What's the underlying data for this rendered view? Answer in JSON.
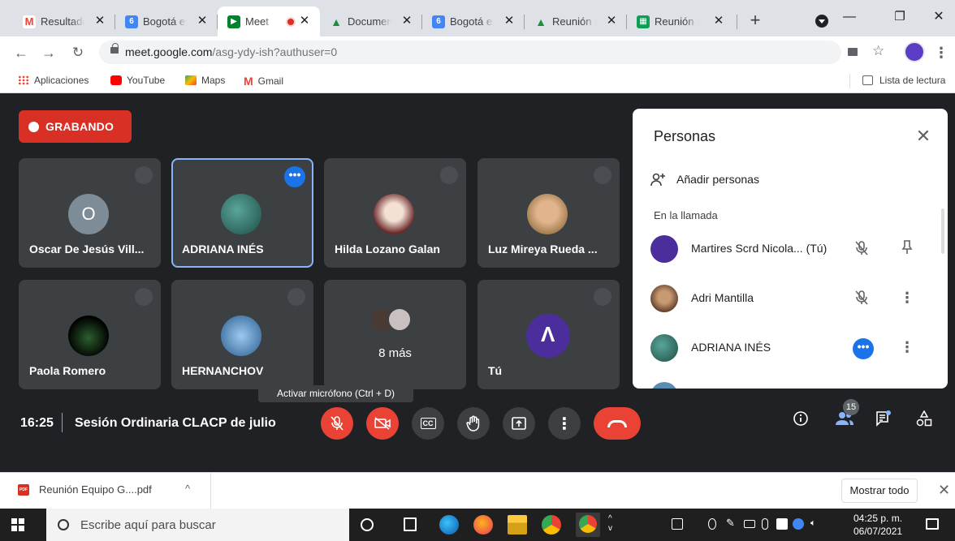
{
  "browser": {
    "tabs": [
      {
        "title": "Resultados",
        "favicon": "gmail-icon",
        "color": "#ea4335"
      },
      {
        "title": "Bogotá es",
        "favicon": "calendar-icon",
        "color": "#4285f4"
      },
      {
        "title": "Meet",
        "favicon": "meet-icon",
        "color": "#00832d"
      },
      {
        "title": "Documento",
        "favicon": "drive-icon",
        "color": "#1e8e3e"
      },
      {
        "title": "Bogotá es",
        "favicon": "calendar-icon",
        "color": "#4285f4"
      },
      {
        "title": "Reunión E",
        "favicon": "drive-icon",
        "color": "#1e8e3e"
      },
      {
        "title": "Reunión E",
        "favicon": "sheets-icon",
        "color": "#0f9d58"
      }
    ],
    "url_host": "meet.google.com",
    "url_path": "/asg-ydy-ish?authuser=0",
    "bookmarks": [
      "Aplicaciones",
      "YouTube",
      "Maps",
      "Gmail"
    ],
    "reading_list": "Lista de lectura"
  },
  "meet": {
    "recording_label": "GRABANDO",
    "tiles": [
      {
        "name": "Oscar De Jesús Vill...",
        "initial": "O"
      },
      {
        "name": "ADRIANA INÉS"
      },
      {
        "name": "Hilda Lozano Galan"
      },
      {
        "name": "Luz Mireya Rueda ..."
      },
      {
        "name": "Paola Romero"
      },
      {
        "name": "HERNANCHOV"
      },
      {
        "name": "",
        "more_label": "8 más"
      },
      {
        "name": "Tú"
      }
    ],
    "tooltip": "Activar micrófono (Ctrl + D)",
    "time": "16:25",
    "meeting_name": "Sesión Ordinaria CLACP de julio",
    "people_count": "15",
    "panel": {
      "title": "Personas",
      "add_people": "Añadir personas",
      "section": "En la llamada",
      "participants": [
        {
          "name": "Martires Scrd Nicola... (Tú)"
        },
        {
          "name": "Adri Mantilla"
        },
        {
          "name": "ADRIANA INÉS"
        }
      ]
    },
    "colors": {
      "record": "#d93025",
      "accent": "#1a73e8",
      "danger": "#ea4335"
    }
  },
  "downloads": {
    "file": "Reunión Equipo G....pdf",
    "show_all": "Mostrar todo"
  },
  "taskbar": {
    "search_placeholder": "Escribe aquí para buscar",
    "time": "04:25 p. m.",
    "date": "06/07/2021"
  }
}
